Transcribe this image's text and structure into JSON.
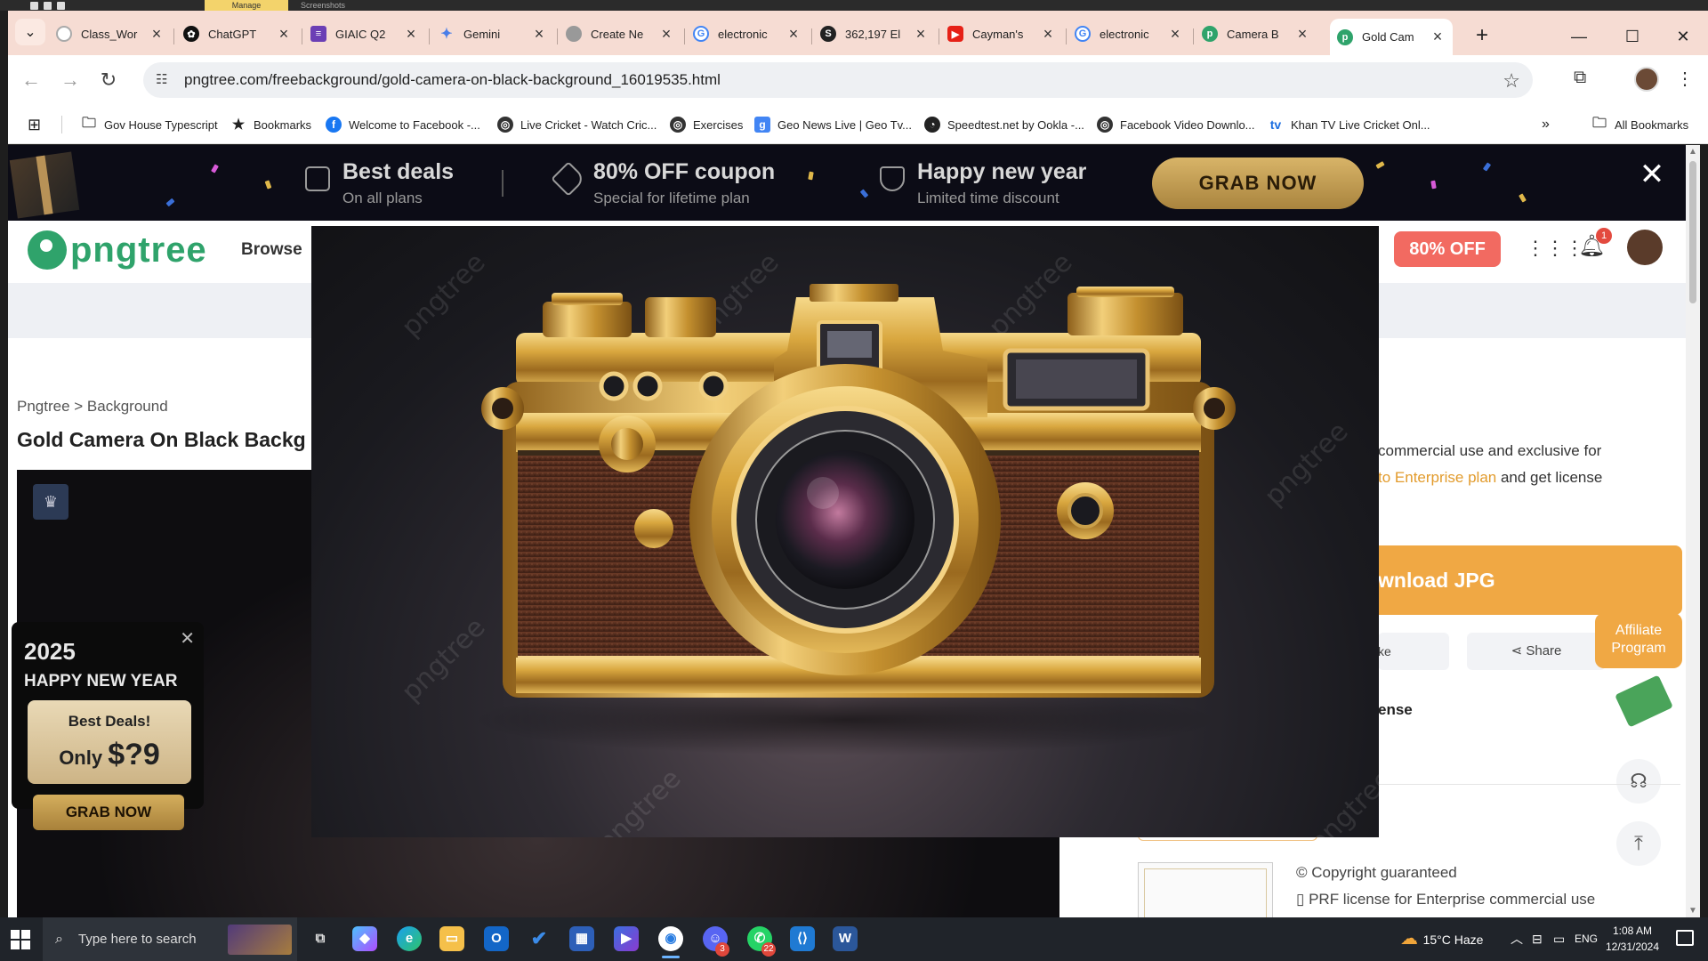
{
  "window": {
    "manage_label": "Manage",
    "screenshots_label": "Screenshots"
  },
  "tabs": [
    {
      "title": "Class_Wor",
      "favicon": "generic-icon"
    },
    {
      "title": "ChatGPT",
      "favicon": "chatgpt-icon"
    },
    {
      "title": "GIAIC Q2",
      "favicon": "forms-icon"
    },
    {
      "title": "Gemini",
      "favicon": "gemini-icon"
    },
    {
      "title": "Create Ne",
      "favicon": "globe-icon"
    },
    {
      "title": "electronic",
      "favicon": "google-icon"
    },
    {
      "title": "362,197 El",
      "favicon": "shutterstock-icon"
    },
    {
      "title": "Cayman's",
      "favicon": "youtube-icon"
    },
    {
      "title": "electronic",
      "favicon": "google-icon"
    },
    {
      "title": "Camera B",
      "favicon": "pngtree-icon"
    },
    {
      "title": "Gold Cam",
      "favicon": "pngtree-icon",
      "active": true
    }
  ],
  "toolbar": {
    "url": "pngtree.com/freebackground/gold-camera-on-black-background_16019535.html"
  },
  "bookmarks": [
    {
      "label": "Gov House Typescript",
      "icon": "folder-icon"
    },
    {
      "label": "Bookmarks",
      "icon": "star-icon"
    },
    {
      "label": "Welcome to Facebook -...",
      "icon": "facebook-icon"
    },
    {
      "label": "Live Cricket - Watch Cric...",
      "icon": "globe-icon"
    },
    {
      "label": "Exercises",
      "icon": "globe-icon"
    },
    {
      "label": "Geo News Live | Geo Tv...",
      "icon": "google-icon"
    },
    {
      "label": "Speedtest.net by Ookla -...",
      "icon": "speedtest-icon"
    },
    {
      "label": "Facebook Video Downlo...",
      "icon": "globe-icon"
    },
    {
      "label": "Khan TV Live Cricket Onl...",
      "icon": "tv-icon"
    }
  ],
  "all_bookmarks": "All Bookmarks",
  "promo": {
    "item1_big": "Best deals",
    "item1_small": "On all plans",
    "item2_big": "80% OFF coupon",
    "item2_small": "Special for lifetime plan",
    "item3_big": "Happy new year",
    "item3_small": "Limited time discount",
    "grab": "GRAB NOW"
  },
  "site": {
    "logo_text": "pngtree",
    "browse": "Browse",
    "off_button": "80% OFF",
    "notification_count": "1"
  },
  "content": {
    "breadcrumb": "Pngtree > Background",
    "title": "Gold Camera On Black Backg",
    "side_text1": "commercial use and exclusive for",
    "side_text2_link": "to Enterprise plan",
    "side_text2_rest": " and get license",
    "download": "wnload JPG",
    "like": "ke",
    "share": "Share",
    "affiliate": "Affiliate Program",
    "license": "ense",
    "copyright": "Copyright guaranteed",
    "prf": "PRF license for Enterprise commercial use"
  },
  "popup": {
    "year": "2025",
    "headline": "HAPPY NEW YEAR",
    "deal1": "Best Deals!",
    "only": "Only",
    "price": "$?9",
    "grab": "GRAB NOW"
  },
  "lightbox": {
    "watermark": "pngtree"
  },
  "taskbar": {
    "search_placeholder": "Type here to search",
    "weather": "15°C  Haze",
    "lang": "ENG",
    "time": "1:08 AM",
    "date": "12/31/2024",
    "discord_badge": "3",
    "whatsapp_badge": "22"
  },
  "colors": {
    "pngtree_green": "#2fa36b",
    "download_orange": "#f0a844",
    "off_red": "#f26a61",
    "tab_strip": "#f6dcd3",
    "gold": "#d4ae5d"
  }
}
